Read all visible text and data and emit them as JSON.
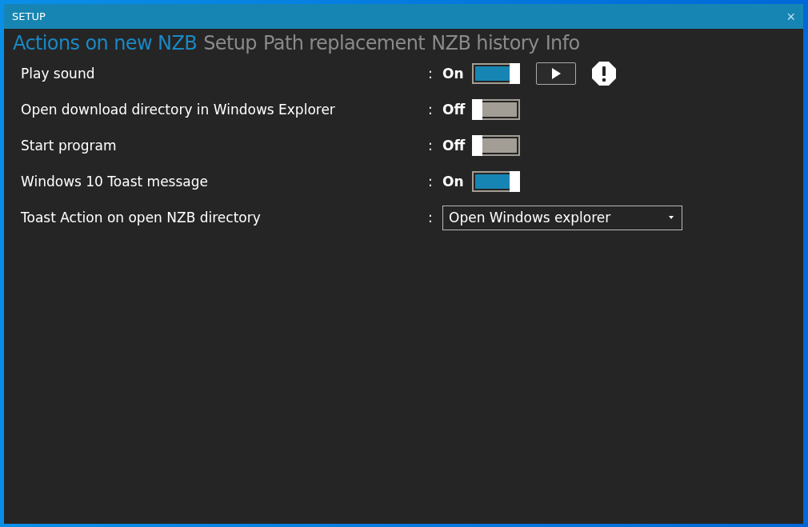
{
  "window": {
    "title": "SETUP",
    "close": "×"
  },
  "tabs": [
    {
      "label": "Actions on new NZB",
      "selected": true
    },
    {
      "label": "Setup",
      "selected": false
    },
    {
      "label": "Path replacement",
      "selected": false
    },
    {
      "label": "NZB history",
      "selected": false
    },
    {
      "label": "Info",
      "selected": false
    }
  ],
  "settings": [
    {
      "kind": "toggle",
      "label": "Play sound",
      "separator": ":",
      "state_text": "On",
      "on": true,
      "extras": [
        {
          "kind": "play-button"
        },
        {
          "kind": "warning"
        }
      ]
    },
    {
      "kind": "toggle",
      "label": "Open download directory in Windows Explorer",
      "separator": ":",
      "state_text": "Off",
      "on": false
    },
    {
      "kind": "toggle",
      "label": "Start program",
      "separator": ":",
      "state_text": "Off",
      "on": false
    },
    {
      "kind": "toggle",
      "label": "Windows 10 Toast message",
      "separator": ":",
      "state_text": "On",
      "on": true
    },
    {
      "kind": "dropdown",
      "label": "Toast Action on open NZB directory",
      "separator": ":",
      "value": "Open Windows explorer"
    }
  ]
}
